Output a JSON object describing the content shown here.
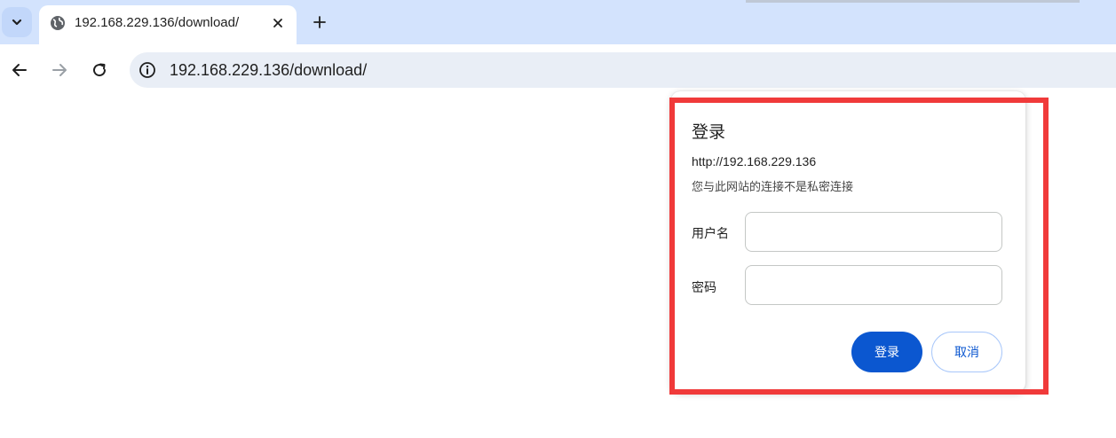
{
  "tab": {
    "title": "192.168.229.136/download/",
    "favicon_icon": "globe-icon",
    "close_icon": "close-icon"
  },
  "tabstrip": {
    "search_icon": "chevron-down-icon",
    "new_tab_icon": "plus-icon"
  },
  "toolbar": {
    "back_icon": "arrow-left-icon",
    "forward_icon": "arrow-right-icon",
    "reload_icon": "reload-icon",
    "site_info_icon": "info-icon",
    "url": "192.168.229.136/download/"
  },
  "dialog": {
    "title": "登录",
    "origin": "http://192.168.229.136",
    "warning": "您与此网站的连接不是私密连接",
    "username_label": "用户名",
    "username_value": "",
    "password_label": "密码",
    "password_value": "",
    "login_button": "登录",
    "cancel_button": "取消"
  },
  "colors": {
    "tabstrip_bg": "#d3e3fd",
    "omnibox_bg": "#e9eef6",
    "primary_button": "#0b57d0",
    "highlight": "#f03a3a"
  }
}
